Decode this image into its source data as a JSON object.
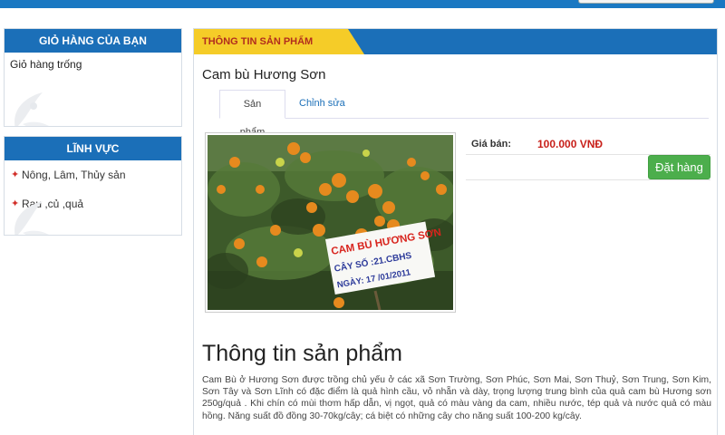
{
  "cart": {
    "title": "GIỎ HÀNG CỦA BẠN",
    "empty_text": "Giỏ hàng trống"
  },
  "fields": {
    "title": "LĨNH VỰC",
    "items": [
      {
        "label": "Nông, Lâm, Thủy sản"
      },
      {
        "label": "Rau ,củ ,quả"
      }
    ]
  },
  "main": {
    "section_title": "THÔNG TIN SẢN PHẨM",
    "product_name": "Cam bù Hương Sơn",
    "tabs": [
      {
        "label": "Sản phẩm",
        "active": true
      },
      {
        "label": "Chỉnh sửa",
        "active": false
      }
    ],
    "image_sign": {
      "line1": "CAM BÙ HƯƠNG SƠN",
      "line2": "CÂY SỐ :21.CBHS",
      "line3": "NGÀY: 17 /01/2011"
    },
    "price_label": "Giá bán:",
    "price_value": "100.000 VNĐ",
    "order_button": "Đặt hàng",
    "info_heading": "Thông tin sản phẩm",
    "description": "Cam Bù ở Hương Sơn được trồng chủ yếu ở các xã Sơn Trường, Sơn Phúc, Sơn Mai, Sơn Thuỷ, Sơn Trung, Sơn Kim, Sơn Tây và Sơn Lĩnh có đặc điểm là quả hình cầu, vỏ nhẵn và dày, trọng lượng trung bình của quả cam bù Hương sơn 250g/quả . Khi chín có mùi thơm hấp dẫn, vị ngọt, quả có màu vàng da cam, nhiều nước, tép quả và nước quả có màu hồng. Năng suất đồ đồng 30-70kg/cây; cá biệt có những cây cho năng suất 100-200 kg/cây."
  },
  "colors": {
    "header_blue": "#1b6fb8",
    "header_yellow": "#f5cc28",
    "price_red": "#c8201a",
    "button_green": "#4cae4c"
  },
  "icons": {
    "list_bullet": "bullet-icon",
    "decoration": "floral-ornament-icon"
  }
}
